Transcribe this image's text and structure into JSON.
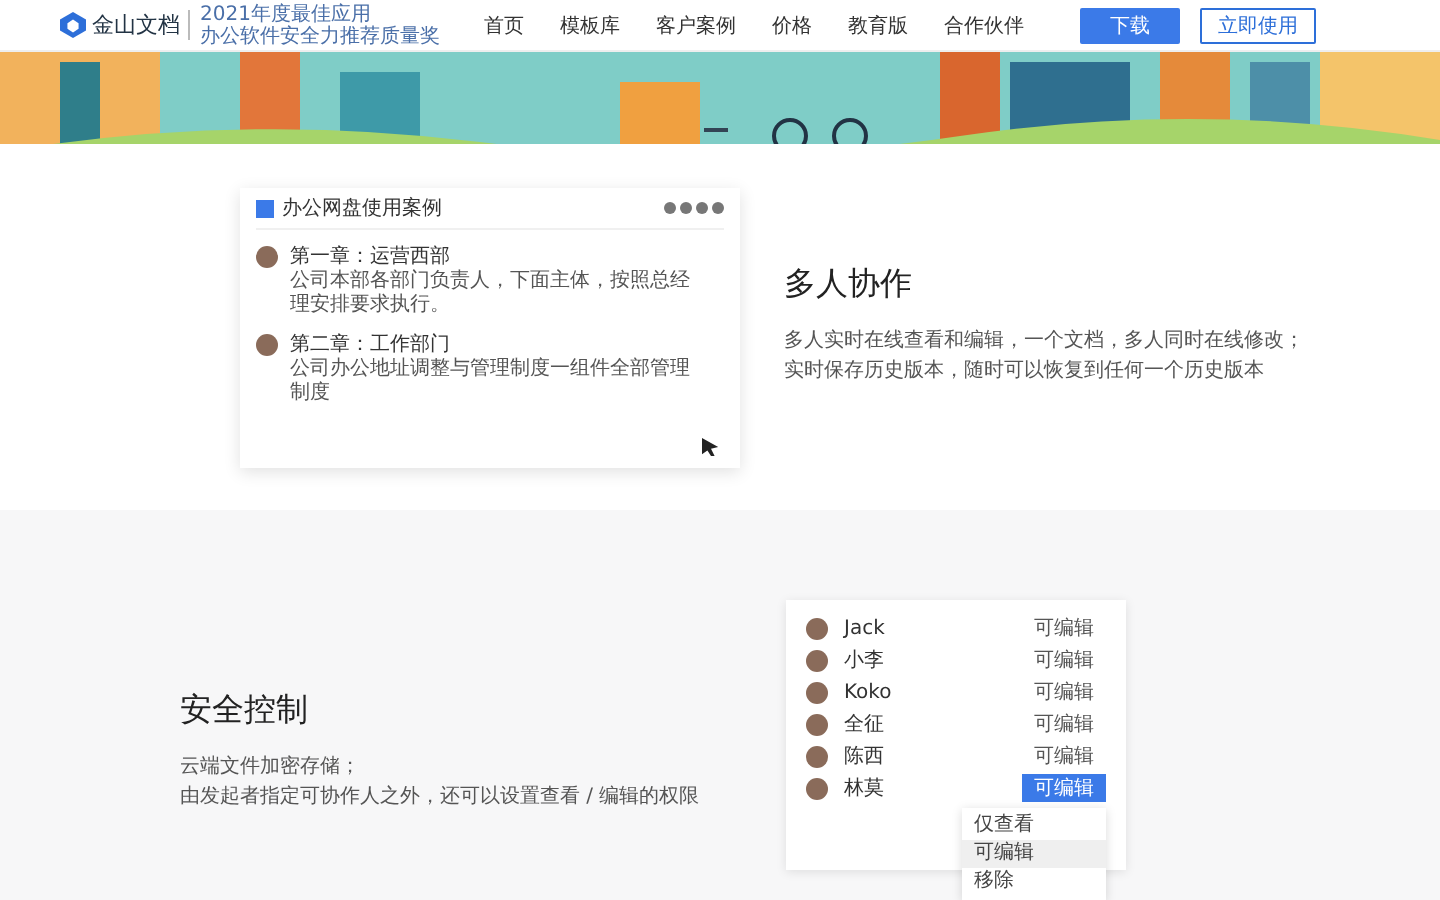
{
  "nav": {
    "logo": "金山文档",
    "tagline": [
      "2021年度最佳应用",
      "办公软件安全力推荐质量奖"
    ],
    "items": [
      {
        "label": "首页",
        "selected": false
      },
      {
        "label": "模板库",
        "selected": false
      },
      {
        "label": "客户案例",
        "selected": false
      },
      {
        "label": "价格",
        "selected": false
      },
      {
        "label": "教育版",
        "selected": false
      },
      {
        "label": "合作伙伴",
        "selected": false
      }
    ],
    "buttons": [
      {
        "label": "下载",
        "kind": "primary"
      },
      {
        "label": "立即使用",
        "kind": "outline"
      }
    ]
  },
  "collab": {
    "title": "多人协作",
    "description": [
      "多人实时在线查看和编辑，一个文档，多人同时在线修改；",
      "实时保存历史版本，随时可以恢复到任何一个历史版本"
    ],
    "doc_card": {
      "title": "办公网盘使用案例",
      "comments": [
        {
          "heading": "第一章：运营西部",
          "body": "公司本部各部门负责人，下面主体，按照总经理安排要求执行。"
        },
        {
          "heading": "第二章：工作部门",
          "body": "公司办公地址调整与管理制度一组件全部管理制度"
        }
      ]
    }
  },
  "security": {
    "title": "安全控制",
    "description": [
      "云端文件加密存储；",
      "由发起者指定可协作人之外，还可以设置查看 / 编辑的权限"
    ],
    "members": [
      {
        "name": "Jack",
        "permission": "可编辑",
        "selected": false
      },
      {
        "name": "小李",
        "permission": "可编辑",
        "selected": false
      },
      {
        "name": "Koko",
        "permission": "可编辑",
        "selected": false
      },
      {
        "name": "全征",
        "permission": "可编辑",
        "selected": false
      },
      {
        "name": "陈西",
        "permission": "可编辑",
        "selected": false
      },
      {
        "name": "林莫",
        "permission": "可编辑",
        "selected": true
      }
    ],
    "menu": [
      {
        "label": "仅查看",
        "selected": false
      },
      {
        "label": "可编辑",
        "selected": true
      },
      {
        "label": "移除",
        "selected": false
      }
    ]
  }
}
